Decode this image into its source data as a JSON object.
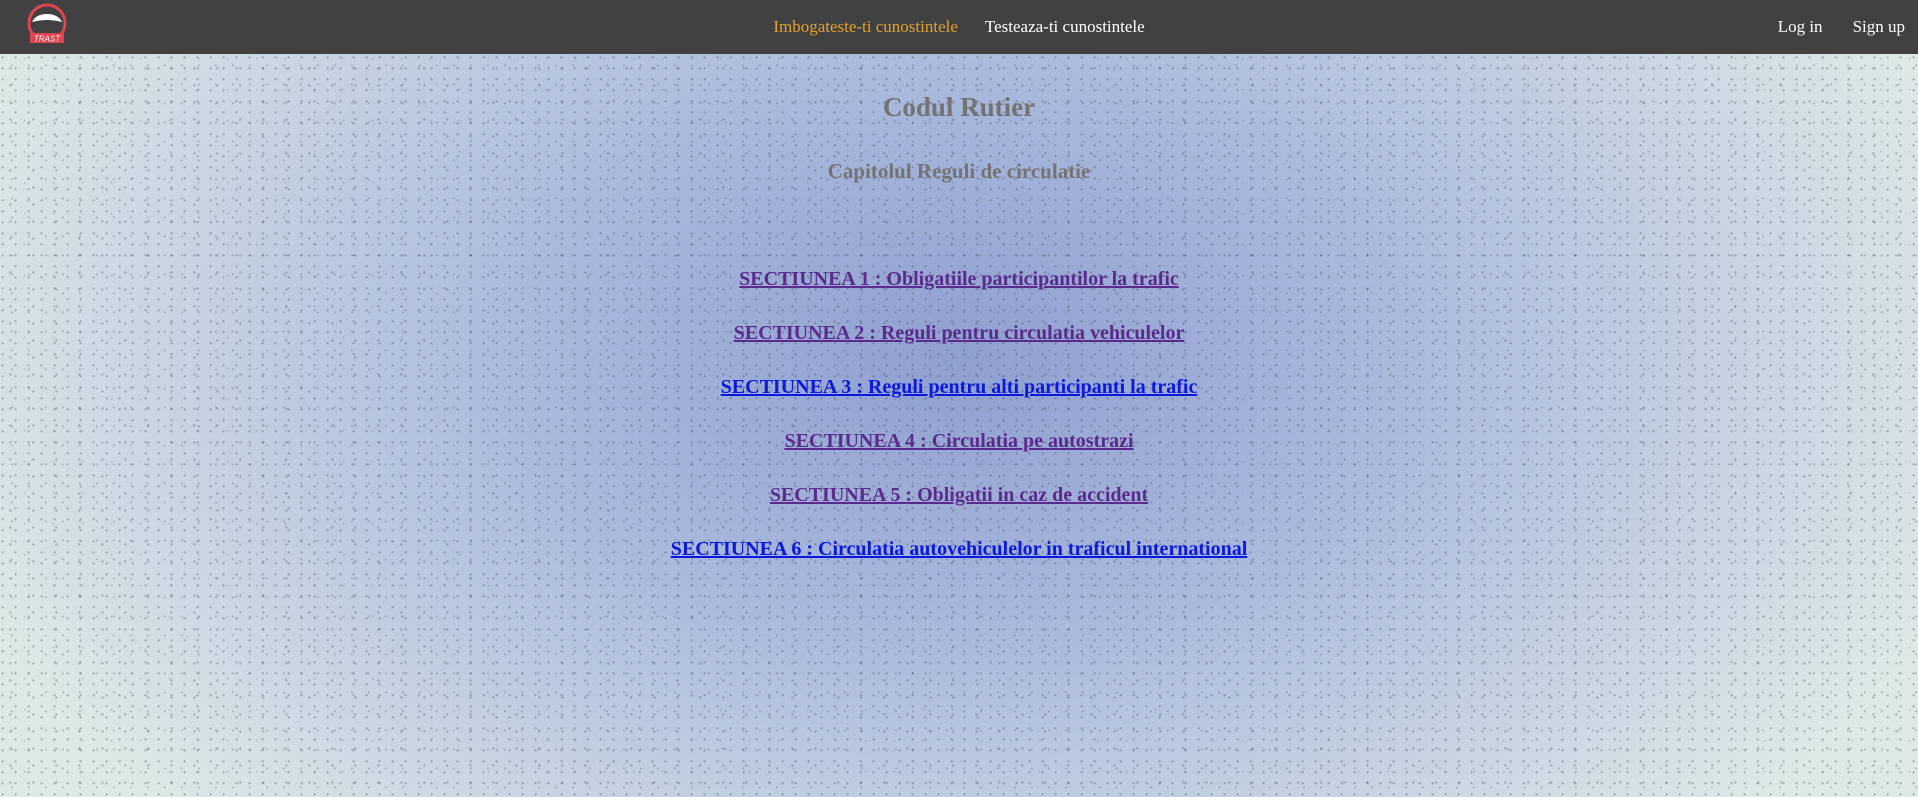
{
  "navbar": {
    "logo_text": "TRAST",
    "links": [
      {
        "label": "Imbogateste-ti cunostintele",
        "active": true
      },
      {
        "label": "Testeaza-ti cunostintele",
        "active": false
      }
    ],
    "auth": {
      "login_label": "Log in",
      "signup_label": "Sign up"
    }
  },
  "main": {
    "title": "Codul Rutier",
    "chapter": "Capitolul Reguli de circulatie",
    "sections": [
      {
        "label": "SECTIUNEA 1 : Obligatiile participantilor la trafic",
        "visited": true
      },
      {
        "label": "SECTIUNEA 2 : Reguli pentru circulatia vehiculelor",
        "visited": true
      },
      {
        "label": "SECTIUNEA 3 : Reguli pentru alti participanti la trafic",
        "visited": false
      },
      {
        "label": "SECTIUNEA 4 : Circulatia pe autostrazi",
        "visited": true
      },
      {
        "label": "SECTIUNEA 5 : Obligatii in caz de accident",
        "visited": true
      },
      {
        "label": "SECTIUNEA 6 : Circulatia autovehiculelor in traficul international",
        "visited": false
      }
    ]
  },
  "colors": {
    "navbar_bg": "#414141",
    "nav_active": "#e0a030",
    "heading": "#737373",
    "link_visited": "#5a2b8c",
    "link_unvisited": "#0a18e0",
    "logo_red": "#e0454f"
  }
}
